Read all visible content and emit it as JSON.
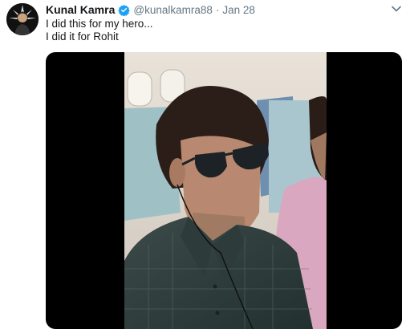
{
  "tweet": {
    "author": {
      "name": "Kunal Kamra",
      "handle": "@kunalkamra88",
      "verified": true
    },
    "separator": "·",
    "date": "Jan 28",
    "text_lines": [
      "I did this for my hero...",
      "I did it for Rohit"
    ]
  },
  "media": {
    "type": "video"
  },
  "icons": {
    "avatar": "avatar",
    "verified": "verified-badge-icon",
    "menu": "chevron-down-icon"
  },
  "colors": {
    "name": "#14171a",
    "secondary": "#657786",
    "verified": "#1da1f2",
    "media_bg": "#000000"
  }
}
